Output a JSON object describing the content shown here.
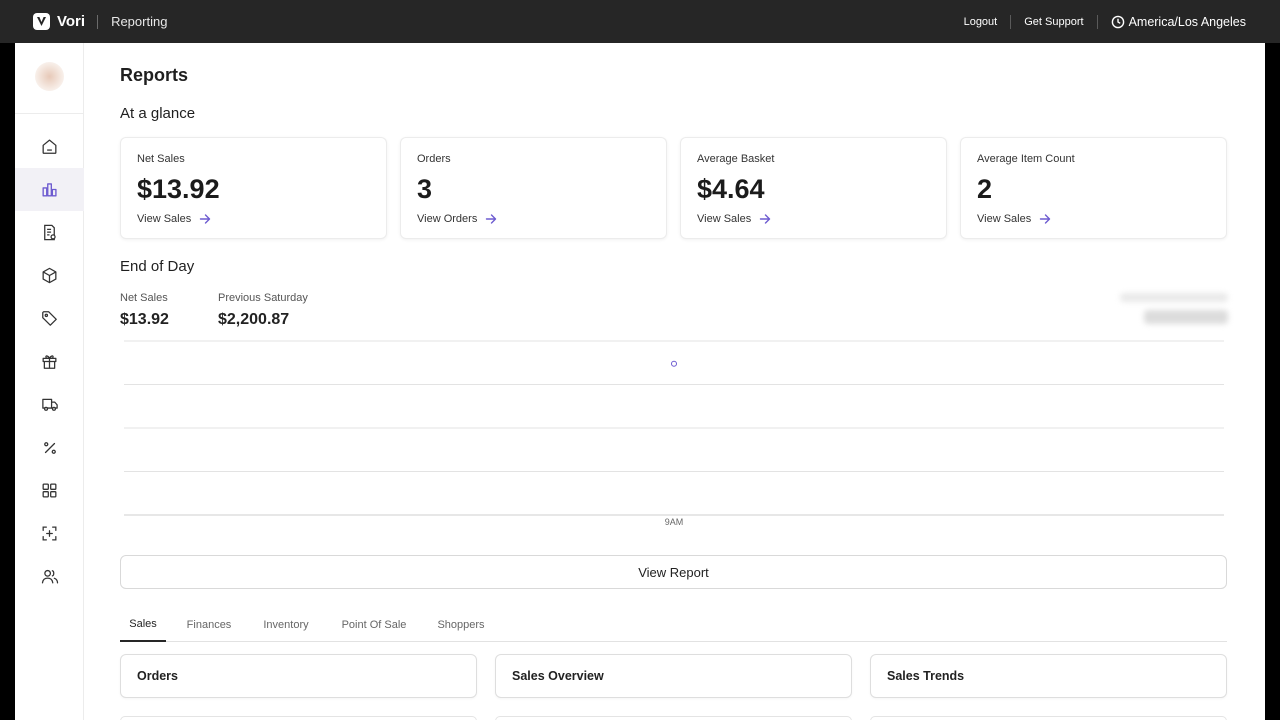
{
  "topbar": {
    "brand": "Vori",
    "app_name": "Reporting",
    "logout": "Logout",
    "support": "Get Support",
    "timezone": "America/Los Angeles"
  },
  "sidebar": {
    "items": [
      {
        "icon": "home-icon",
        "active": false
      },
      {
        "icon": "bar-chart-icon",
        "active": true
      },
      {
        "icon": "invoice-icon",
        "active": false
      },
      {
        "icon": "box-icon",
        "active": false
      },
      {
        "icon": "tag-icon",
        "active": false
      },
      {
        "icon": "gift-icon",
        "active": false
      },
      {
        "icon": "truck-icon",
        "active": false
      },
      {
        "icon": "percent-icon",
        "active": false
      },
      {
        "icon": "grid-icon",
        "active": false
      },
      {
        "icon": "scan-icon",
        "active": false
      },
      {
        "icon": "users-icon",
        "active": false
      }
    ]
  },
  "page": {
    "title": "Reports",
    "glance_title": "At a glance",
    "eod_title": "End of Day"
  },
  "cards": [
    {
      "label": "Net Sales",
      "value": "$13.92",
      "link": "View Sales"
    },
    {
      "label": "Orders",
      "value": "3",
      "link": "View Orders"
    },
    {
      "label": "Average Basket",
      "value": "$4.64",
      "link": "View Sales"
    },
    {
      "label": "Average Item Count",
      "value": "2",
      "link": "View Sales"
    }
  ],
  "eod": {
    "net_sales_label": "Net Sales",
    "net_sales_value": "$13.92",
    "prev_label": "Previous Saturday",
    "prev_value": "$2,200.87"
  },
  "chart_data": {
    "type": "line",
    "x_ticks": [
      "9AM"
    ],
    "points": [
      {
        "x": "9AM",
        "y": 13.92
      }
    ],
    "grid": true,
    "series_color": "#6d5bd0"
  },
  "view_report": "View Report",
  "tabs": [
    "Sales",
    "Finances",
    "Inventory",
    "Point Of Sale",
    "Shoppers"
  ],
  "active_tab": "Sales",
  "report_cards": [
    "Orders",
    "Sales Overview",
    "Sales Trends"
  ],
  "colors": {
    "accent": "#6d5bd0",
    "topbar": "#262626"
  }
}
